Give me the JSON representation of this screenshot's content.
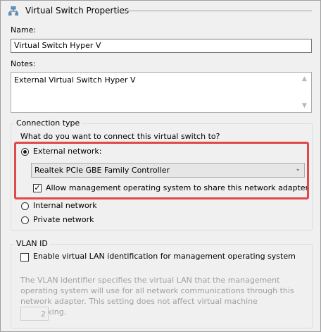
{
  "header": {
    "title": "Virtual Switch Properties",
    "icon": "network-switch-icon"
  },
  "name": {
    "label": "Name:",
    "value": "Virtual Switch Hyper V"
  },
  "notes": {
    "label": "Notes:",
    "value": "External Virtual Switch Hyper V"
  },
  "connection": {
    "group_title": "Connection type",
    "question": "What do you want to connect this virtual switch to?",
    "external": {
      "label": "External network:",
      "selected": true
    },
    "adapter_select": {
      "value": "Realtek PCIe GBE Family Controller"
    },
    "allow_mgmt": {
      "label": "Allow management operating system to share this network adapter",
      "checked": true
    },
    "internal": {
      "label": "Internal network",
      "selected": false
    },
    "private": {
      "label": "Private network",
      "selected": false
    }
  },
  "vlan": {
    "group_title": "VLAN ID",
    "enable": {
      "label": "Enable virtual LAN identification for management operating system",
      "checked": false
    },
    "description": "The VLAN identifier specifies the virtual LAN that the management operating system will use for all network communications through this network adapter. This setting does not affect virtual machine networking.",
    "value": "2"
  },
  "colors": {
    "highlight": "#e0494a"
  }
}
